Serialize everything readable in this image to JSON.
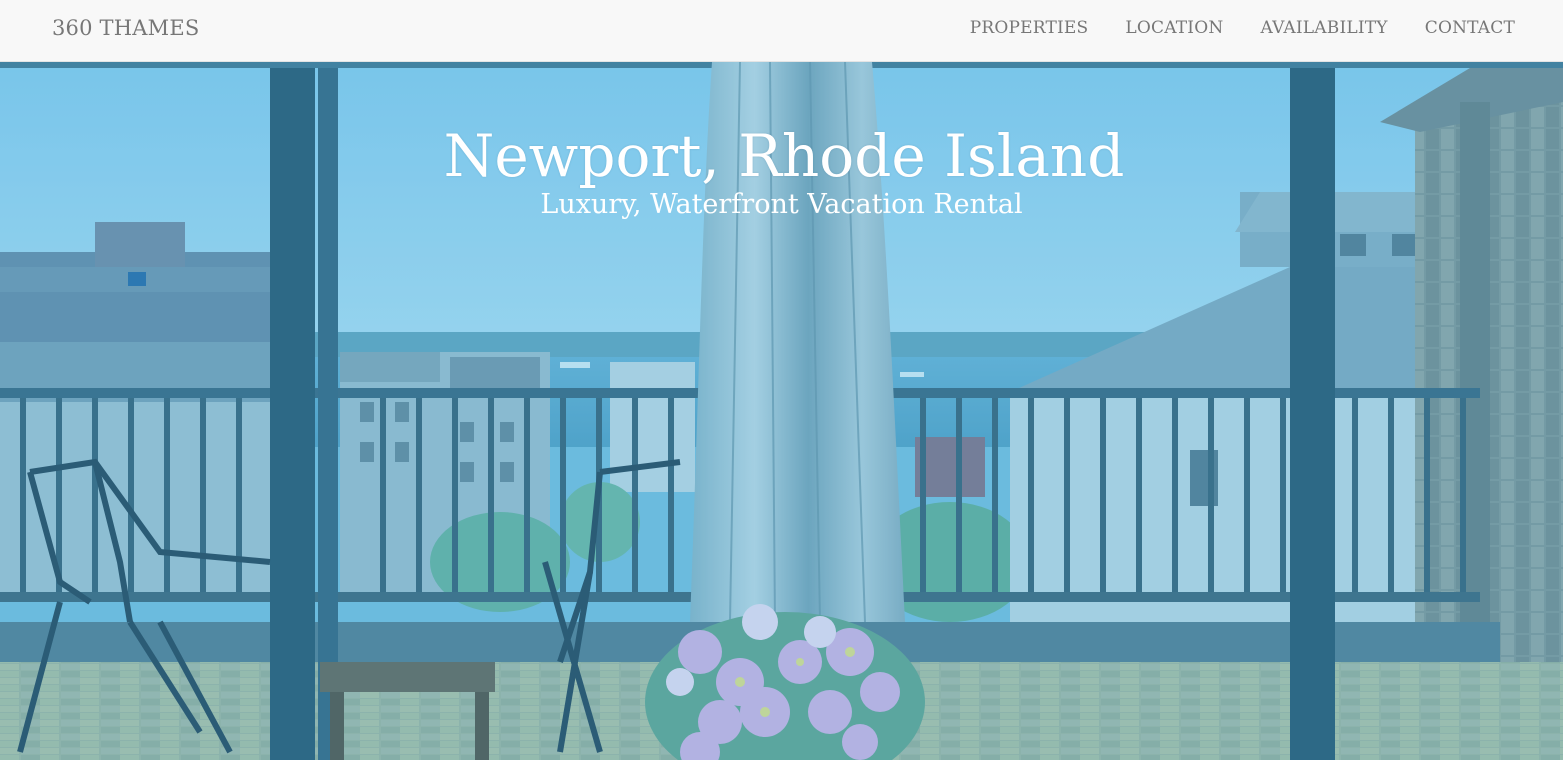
{
  "navbar": {
    "brand": "360 THAMES",
    "links": [
      {
        "label": "PROPERTIES"
      },
      {
        "label": "LOCATION"
      },
      {
        "label": "AVAILABILITY"
      },
      {
        "label": "CONTACT"
      }
    ]
  },
  "hero": {
    "title": "Newport, Rhode Island",
    "subtitle": "Luxury, Waterfront Vacation Rental",
    "overlay_color": "#2aa0d8"
  }
}
